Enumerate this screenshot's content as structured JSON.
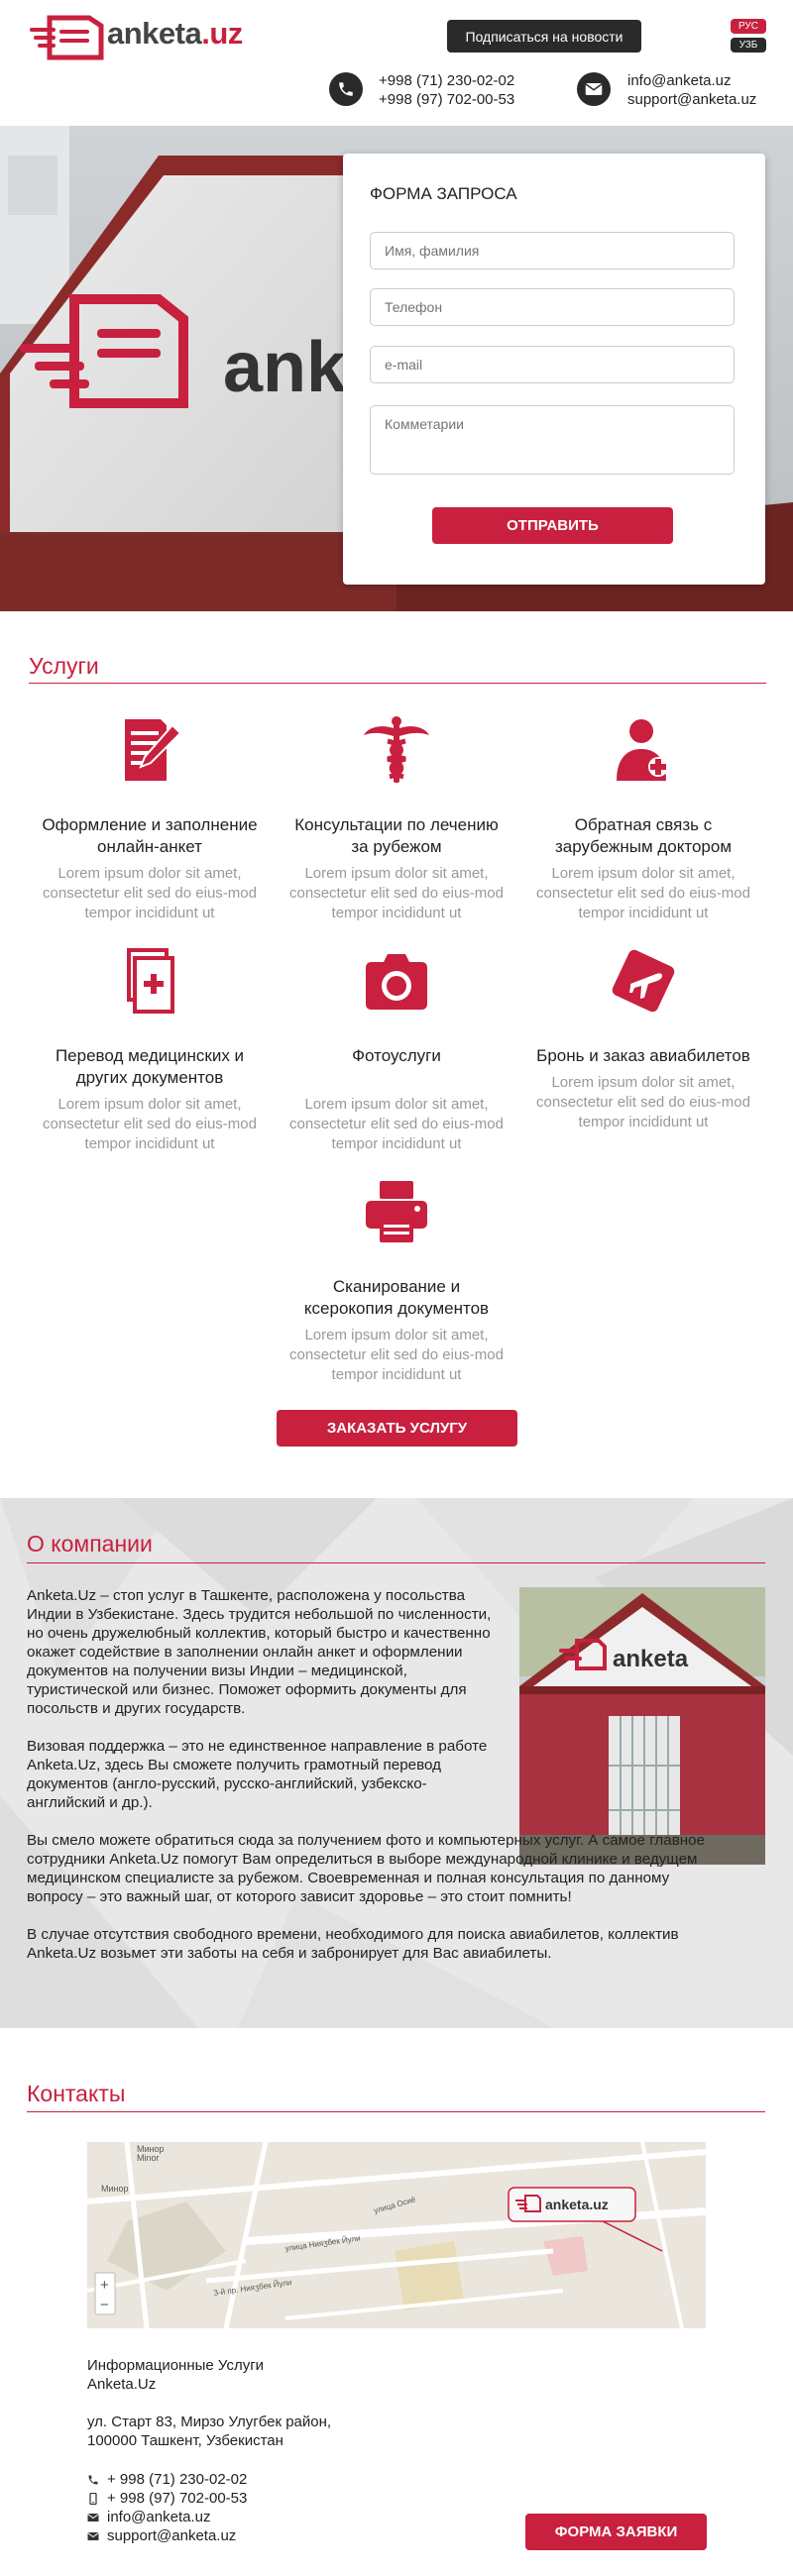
{
  "brand": {
    "name_main": "anketa",
    "name_suffix": ".uz",
    "accent": "#c8203e",
    "dark": "#2a2a2a"
  },
  "header": {
    "subscribe_label": "Подписаться на новости",
    "languages": [
      "РУС",
      "УЗБ"
    ],
    "phone_icon": "phone-icon",
    "phones": [
      "+998 (71) 230-02-02",
      "+998 (97) 702-00-53"
    ],
    "mail_icon": "envelope-icon",
    "emails": [
      "info@anketa.uz",
      "support@anketa.uz"
    ]
  },
  "request_form": {
    "title": "ФОРМА ЗАПРОСА",
    "name_placeholder": "Имя, фамилия",
    "phone_placeholder": "Телефон",
    "email_placeholder": "e-mail",
    "comment_placeholder": "Комметарии",
    "submit_label": "ОТПРАВИТЬ"
  },
  "services": {
    "title": "Услуги",
    "items": [
      {
        "icon": "document-pencil-icon",
        "name": "Оформление и заполнение онлайн-анкет",
        "desc": "Lorem ipsum dolor sit amet, consectetur elit sed do eius-mod tempor incididunt ut"
      },
      {
        "icon": "caduceus-icon",
        "name": "Консультации по лечению за рубежом",
        "desc": "Lorem ipsum dolor sit amet, consectetur elit sed do eius-mod tempor incididunt ut"
      },
      {
        "icon": "doctor-icon",
        "name": "Обратная связь с зарубежным доктором",
        "desc": "Lorem ipsum dolor sit amet, consectetur elit sed do eius-mod tempor incididunt ut"
      },
      {
        "icon": "medical-documents-icon",
        "name": "Перевод медицинских и других документов",
        "desc": "Lorem ipsum dolor sit amet, consectetur elit sed do eius-mod tempor incididunt ut"
      },
      {
        "icon": "camera-icon",
        "name": "Фотоуслуги",
        "desc": "Lorem ipsum dolor sit amet, consectetur elit sed do eius-mod tempor incididunt ut"
      },
      {
        "icon": "plane-ticket-icon",
        "name": "Бронь и заказ авиабилетов",
        "desc": "Lorem ipsum dolor sit amet, consectetur elit sed do eius-mod tempor incididunt ut"
      },
      {
        "icon": "printer-icon",
        "name": "Сканирование и ксерокопия документов",
        "desc": "Lorem ipsum dolor sit amet, consectetur elit sed do eius-mod tempor incididunt ut"
      }
    ],
    "order_label": "ЗАКАЗАТЬ УСЛУГУ"
  },
  "about": {
    "title": "О компании",
    "paragraphs": [
      "Anketa.Uz – стоп услуг в Ташкенте, расположена у посольства Индии в Узбекистане. Здесь трудится небольшой по численности, но очень дружелюбный коллектив, который быстро и качественно окажет содействие в заполнении онлайн анкет и оформлении документов на получении визы Индии – медицинской, туристической или бизнес. Поможет оформить документы для посольств и других государств.",
      "Визовая поддержка – это не единственное направление в работе Anketa.Uz, здесь Вы сможете получить грамотный перевод  документов (англо-русский, русско-английский, узбекско-английский и др.).",
      "Вы смело можете обратиться сюда за получением фото и компьютерных услуг. А самое главное сотрудники Anketa.Uz помогут Вам определиться в выборе международной клинике и ведущем медицинском специалисте за рубежом. Своевременная и полная консультация по данному вопросу – это важный шаг, от которого зависит здоровье – это стоит помнить!",
      "В случае отсутствия свободного времени, необходимого для поиска авиабилетов, коллектив Anketa.Uz возьмет эти заботы на себя и забронирует для Вас авиабилеты."
    ]
  },
  "contacts": {
    "title": "Контакты",
    "map": {
      "labels": [
        "Минор",
        "Minor",
        "Минор",
        "улица Осиё",
        "улица Нияӡбек Йули",
        "3-й пр. Нияӡбек Йули"
      ],
      "zoom_in": "+",
      "zoom_out": "−",
      "marker_text": "anketa.uz"
    },
    "company_line1": "Информационные Услуги",
    "company_line2": "Anketa.Uz",
    "address_line1": "ул. Старт 83, Мирзо Улугбек район,",
    "address_line2": "100000 Ташкент, Узбекистан",
    "phones": [
      "+ 998 (71) 230-02-02",
      "+ 998 (97) 702-00-53"
    ],
    "emails": [
      "info@anketa.uz",
      "support@anketa.uz"
    ],
    "form_button": "ФОРМА ЗАЯВКИ"
  }
}
